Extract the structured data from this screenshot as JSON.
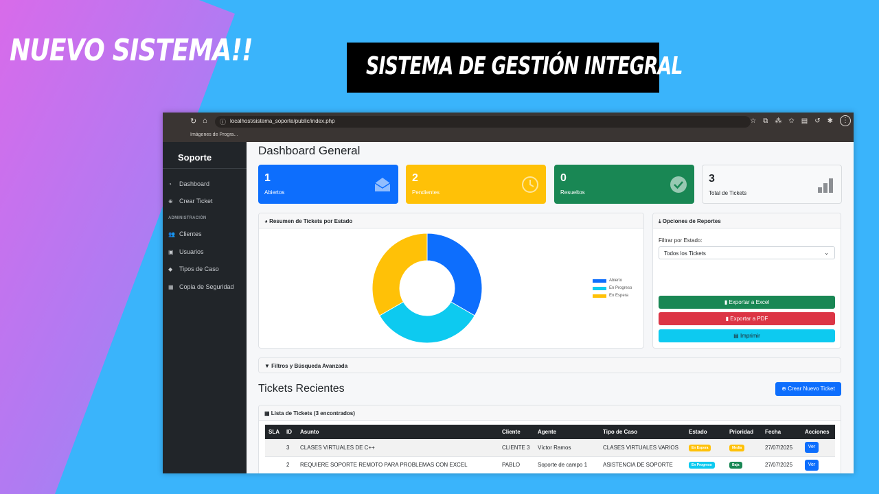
{
  "promo": {
    "headline": "NUEVO SISTEMA!!",
    "banner": "SISTEMA DE GESTIÓN INTEGRAL"
  },
  "browser": {
    "url": "localhost/sistema_soporte/public/index.php",
    "bookmark": "Imágenes de Progra..."
  },
  "sidebar": {
    "brand": "Soporte",
    "admin_heading": "ADMINISTRACIÓN",
    "items": [
      {
        "label": "Dashboard",
        "icon": "speedometer-icon"
      },
      {
        "label": "Crear Ticket",
        "icon": "plus-circle-icon"
      },
      {
        "label": "Clientes",
        "icon": "people-icon"
      },
      {
        "label": "Usuarios",
        "icon": "person-badge-icon"
      },
      {
        "label": "Tipos de Caso",
        "icon": "tag-icon"
      },
      {
        "label": "Copia de Seguridad",
        "icon": "database-icon"
      }
    ]
  },
  "dashboard": {
    "title": "Dashboard General",
    "stats": [
      {
        "value": "1",
        "label": "Abiertos",
        "color": "#0d6efd",
        "icon": "envelope-open-icon"
      },
      {
        "value": "2",
        "label": "Pendientes",
        "color": "#ffc107",
        "icon": "clock-icon"
      },
      {
        "value": "0",
        "label": "Resueltos",
        "color": "#198754",
        "icon": "check-circle-icon"
      },
      {
        "value": "3",
        "label": "Total de Tickets",
        "color": "#f8f9fa",
        "icon": "bar-chart-icon"
      }
    ]
  },
  "summary": {
    "title": "Resumen de Tickets por Estado"
  },
  "chart_data": {
    "type": "pie",
    "donut": true,
    "categories": [
      "Abierto",
      "En Progreso",
      "En Espera"
    ],
    "values": [
      1,
      1,
      1
    ],
    "colors": [
      "#0d6efd",
      "#0dcaf0",
      "#ffc107"
    ],
    "legend": "right"
  },
  "reports": {
    "title": "Opciones de Reportes",
    "filter_label": "Filtrar por Estado:",
    "filter_value": "Todos los Tickets",
    "buttons": [
      {
        "label": "Exportar a Excel",
        "color": "#198754"
      },
      {
        "label": "Exportar a PDF",
        "color": "#dc3545"
      },
      {
        "label": "Imprimir",
        "color": "#0dcaf0"
      }
    ]
  },
  "filters": {
    "title": "Filtros y Búsqueda Avanzada"
  },
  "tickets": {
    "title": "Tickets Recientes",
    "new_button": "Crear Nuevo Ticket",
    "list_title": "Lista de Tickets (3 encontrados)",
    "columns": [
      "SLA",
      "ID",
      "Asunto",
      "Cliente",
      "Agente",
      "Tipo de Caso",
      "Estado",
      "Prioridad",
      "Fecha",
      "Acciones"
    ],
    "rows": [
      {
        "sla": "",
        "id": "3",
        "subject": "CLASES VIRTUALES DE C++",
        "client": "CLIENTE 3",
        "agent": "Víctor Ramos",
        "type": "CLASES VIRTUALES VARIOS",
        "status": "En Espera",
        "status_color": "#ffc107",
        "priority": "Media",
        "priority_color": "#ffc107",
        "date": "27/07/2025",
        "action": "Ver"
      },
      {
        "sla": "",
        "id": "2",
        "subject": "REQUIERE SOPORTE REMOTO PARA PROBLEMAS CON EXCEL",
        "client": "PABLO",
        "agent": "Soporte de campo 1",
        "type": "ASISTENCIA DE SOPORTE",
        "status": "En Progreso",
        "status_color": "#0dcaf0",
        "priority": "Baja",
        "priority_color": "#198754",
        "date": "27/07/2025",
        "action": "Ver"
      }
    ]
  }
}
